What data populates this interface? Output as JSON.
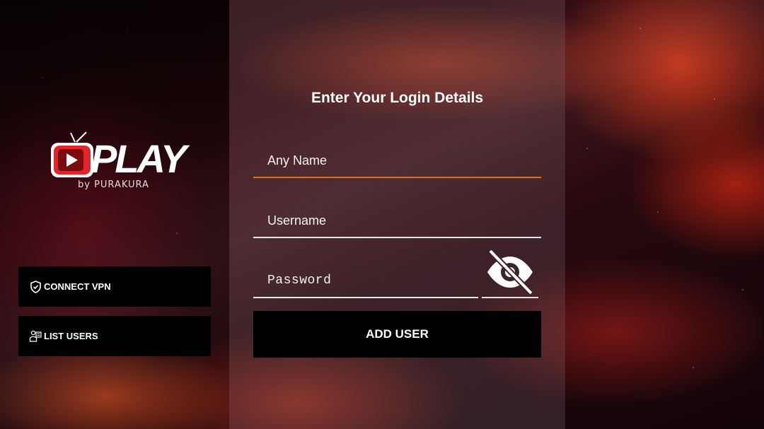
{
  "brand": {
    "name": "PLAY",
    "subtitle": "by PURAKURA",
    "logo_red": "#e0262b",
    "logo_dark_red": "#7a0c0f"
  },
  "sidebar": {
    "connect_vpn": {
      "label": "CONNECT VPN",
      "icon": "shield-check-icon"
    },
    "list_users": {
      "label": "LIST USERS",
      "icon": "users-list-icon"
    }
  },
  "form": {
    "title": "Enter Your Login Details",
    "name_field": {
      "placeholder": "Any Name",
      "value": "",
      "accent": "#d9731c"
    },
    "username_field": {
      "placeholder": "Username",
      "value": ""
    },
    "password_field": {
      "placeholder": "Password",
      "value": ""
    },
    "password_toggle": {
      "icon": "eye-off-icon"
    },
    "submit_label": "ADD USER"
  }
}
